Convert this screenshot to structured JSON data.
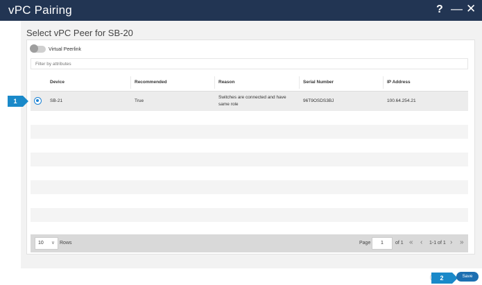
{
  "window": {
    "title": "vPC Pairing",
    "help_icon": "?",
    "minimize_icon": "—",
    "close_icon": "✕"
  },
  "subtitle": "Select vPC Peer for SB-20",
  "virtual_peerlink": {
    "label": "Virtual Peerlink",
    "enabled": false
  },
  "filter": {
    "placeholder": "Filter by attributes"
  },
  "table": {
    "columns": [
      "Device",
      "Recommended",
      "Reason",
      "Serial Number",
      "IP Address"
    ],
    "rows": [
      {
        "selected": true,
        "device": "SB-21",
        "recommended": "True",
        "reason_line1": "Switches are connected and have",
        "reason_line2": "same role",
        "serial": "96T9OSDS3BJ",
        "ip": "100.64.254.21"
      }
    ]
  },
  "pagination": {
    "rows_per_page": "10",
    "rows_label": "Rows",
    "page_label": "Page",
    "page_value": "1",
    "of_label": "of 1",
    "range_label": "1-1 of 1",
    "first_icon": "«",
    "prev_icon": "‹",
    "next_icon": "›",
    "last_icon": "»",
    "chevron_icon": "∨"
  },
  "callouts": {
    "step1": "1",
    "step2": "2"
  },
  "actions": {
    "save_label": "Save"
  }
}
